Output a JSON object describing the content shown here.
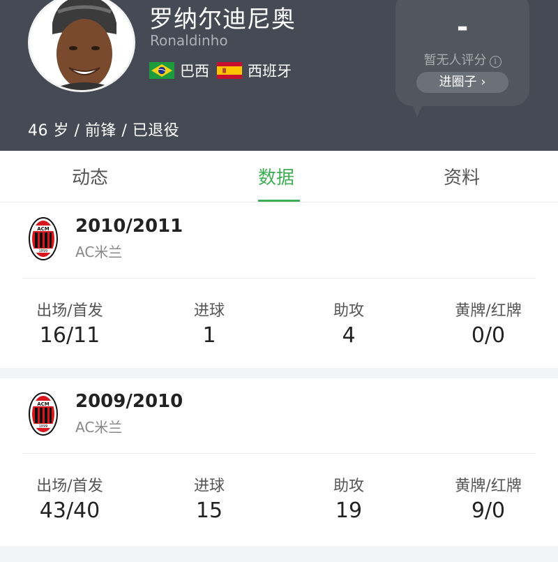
{
  "player": {
    "name": "罗纳尔迪尼奥",
    "name_en": "Ronaldinho",
    "nationalities": [
      {
        "flag_icon": "brazil-flag-icon",
        "name": "巴西"
      },
      {
        "flag_icon": "spain-flag-icon",
        "name": "西班牙"
      }
    ],
    "meta": "46 岁 / 前锋  / 已退役"
  },
  "rating": {
    "score": "-",
    "label": "暂无人评分",
    "info_icon": "info-icon",
    "button_label": "进圈子 ›"
  },
  "tabs": [
    {
      "label": "动态",
      "active": false
    },
    {
      "label": "数据",
      "active": true
    },
    {
      "label": "资料",
      "active": false
    }
  ],
  "colors": {
    "header_bg": "#454a54",
    "accent": "#3fae56",
    "ac_milan_red": "#d7161e"
  },
  "seasons": [
    {
      "season": "2010/2011",
      "club": "AC米兰",
      "club_badge_icon": "ac-milan-badge-icon",
      "stats": [
        {
          "label": "出场/首发",
          "value": "16/11"
        },
        {
          "label": "进球",
          "value": "1"
        },
        {
          "label": "助攻",
          "value": "4"
        },
        {
          "label": "黄牌/红牌",
          "value": "0/0"
        }
      ]
    },
    {
      "season": "2009/2010",
      "club": "AC米兰",
      "club_badge_icon": "ac-milan-badge-icon",
      "stats": [
        {
          "label": "出场/首发",
          "value": "43/40"
        },
        {
          "label": "进球",
          "value": "15"
        },
        {
          "label": "助攻",
          "value": "19"
        },
        {
          "label": "黄牌/红牌",
          "value": "9/0"
        }
      ]
    }
  ]
}
